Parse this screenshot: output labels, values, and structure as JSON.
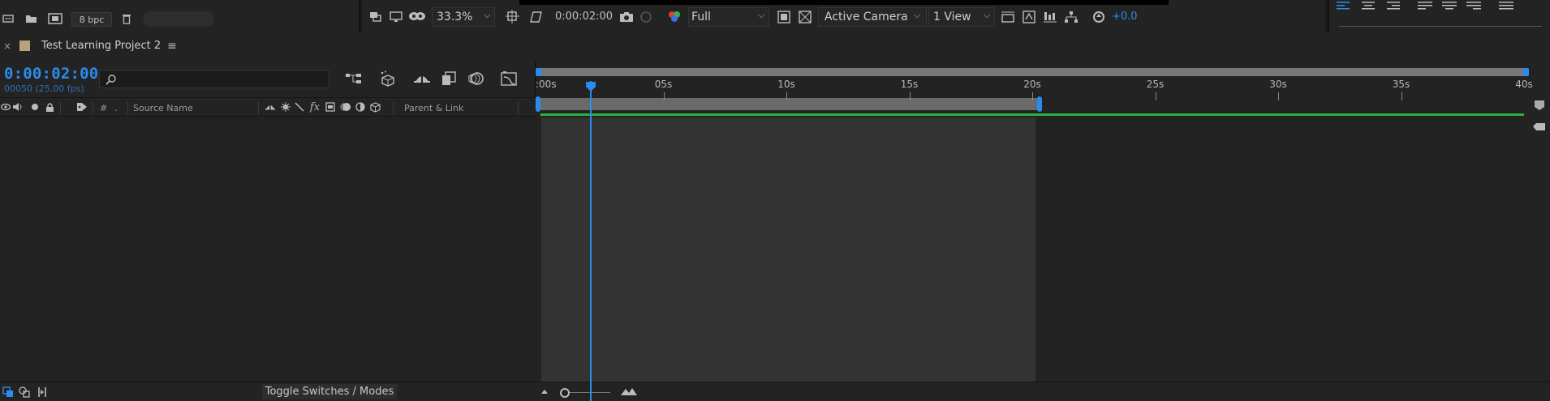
{
  "project_toolbar": {
    "bpc_label": "8 bpc"
  },
  "viewer_toolbar": {
    "zoom": "33.3%",
    "timecode": "0:00:02:00",
    "resolution": "Full",
    "camera": "Active Camera",
    "view_layout": "1 View",
    "exposure": "+0.0"
  },
  "timeline": {
    "tab_title": "Test Learning Project 2",
    "current_time": "0:00:02:00",
    "frame_info": "00050 (25.00 fps)",
    "search_placeholder": "",
    "columns": {
      "label_hash": "#",
      "source_name": "Source Name",
      "parent_link": "Parent & Link"
    },
    "ruler_ticks": [
      ":00s",
      "05s",
      "10s",
      "15s",
      "20s",
      "25s",
      "30s",
      "35s",
      "40s"
    ],
    "toggle_modes_label": "Toggle Switches / Modes"
  },
  "colors": {
    "accent": "#2b8ceb",
    "work_area_bar": "#28b33a",
    "panel_bg": "#232323",
    "project_color": "#b8a27a"
  }
}
